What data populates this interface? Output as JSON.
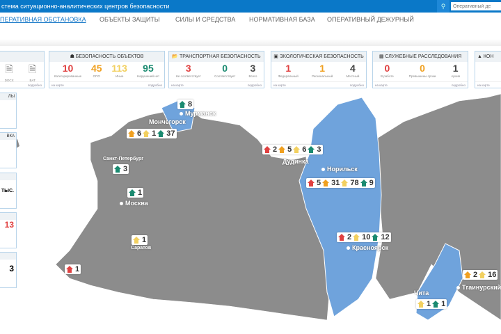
{
  "header": {
    "title": "стема ситуационно-аналитических центров безопасности",
    "search_placeholder": "Оперативный де"
  },
  "nav": [
    "ПЕРАТИВНАЯ ОБСТАНОВКА",
    "ОБЪЕКТЫ ЗАЩИТЫ",
    "СИЛЫ И СРЕДСТВА",
    "НОРМАТИВНАЯ БАЗА",
    "ОПЕРАТИВНЫЙ ДЕЖУРНЫЙ"
  ],
  "cards": [
    {
      "title": "",
      "values": [],
      "labels": [
        "DOCX",
        "BAT"
      ],
      "map": "",
      "more": "подробно"
    },
    {
      "title": "БЕЗОПАСНОСТЬ ОБЪЕКТОВ",
      "values": [
        "10",
        "45",
        "113",
        "95"
      ],
      "labels": [
        "Категорированные",
        "ОПО",
        "Иные",
        "Нарушений нет"
      ],
      "map": "на карте",
      "more": "подробно"
    },
    {
      "title": "ТРАНСПОРТНАЯ БЕЗОПАСНОСТЬ",
      "values": [
        "3",
        "0",
        "3"
      ],
      "labels": [
        "Не соответствует",
        "Соответствует",
        "Всего"
      ],
      "map": "на карте",
      "more": "подробно"
    },
    {
      "title": "ЭКОЛОГИЧЕСКАЯ БЕЗОПАСНОСТЬ",
      "values": [
        "1",
        "1",
        "4"
      ],
      "labels": [
        "Федеральный",
        "Региональный",
        "Местный"
      ],
      "map": "на карте",
      "more": "подробно"
    },
    {
      "title": "СЛУЖЕБНЫЕ РАССЛЕДОВАНИЯ",
      "values": [
        "0",
        "0",
        "1"
      ],
      "labels": [
        "В работе",
        "Превышены сроки",
        "Архив"
      ],
      "map": "на карте",
      "more": "подробно"
    },
    {
      "title": "КОН",
      "map": "на карте"
    }
  ],
  "left_cards": [
    {
      "title": "ЛЫ",
      "value": ""
    },
    {
      "title": "ВКА",
      "value": ""
    },
    {
      "title": "",
      "value": "ТЫС."
    },
    {
      "title": "",
      "value": "13"
    },
    {
      "title": "",
      "value": "3"
    }
  ],
  "cities": [
    "Мурманск",
    "Мончегорск",
    "Санкт-Петербург",
    "Москва",
    "Саратов",
    "Дудинка",
    "Норильск",
    "Красноярск",
    "Чита",
    "Тгаинурский"
  ],
  "markers": [
    {
      "counts": [
        "8"
      ]
    },
    {
      "counts": [
        "6",
        "1",
        "37"
      ]
    },
    {
      "counts": [
        "3"
      ]
    },
    {
      "counts": [
        "1"
      ]
    },
    {
      "counts": [
        "1"
      ]
    },
    {
      "counts": [
        "1"
      ]
    },
    {
      "counts": [
        "2",
        "5",
        "6",
        "3"
      ]
    },
    {
      "counts": [
        "5",
        "31",
        "78",
        "9"
      ]
    },
    {
      "counts": [
        "2",
        "10",
        "12"
      ]
    },
    {
      "counts": [
        "2",
        "16"
      ]
    },
    {
      "counts": [
        "1",
        "1"
      ]
    }
  ],
  "colors": {
    "accent": "#0a78c8",
    "map_region": "#8c8c8c",
    "highlight": "#6fa3dc"
  }
}
